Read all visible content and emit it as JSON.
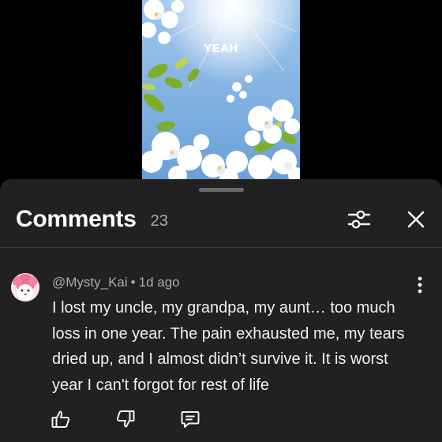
{
  "video": {
    "caption": "YEAH"
  },
  "comments_panel": {
    "title": "Comments",
    "count": "23",
    "filter_icon": "sliders-icon",
    "close_icon": "close-icon"
  },
  "comment": {
    "author": "@Mysty_Kai",
    "separator": "•",
    "time": "1d ago",
    "text": "I lost my uncle, my grandpa, my aunt… too much loss in one year. The pain exhausted me, my tears dried up, and I almost didn’t survive it. It is worst year I can't forgot for rest of life",
    "icons": [
      "avatar",
      "more-vert-icon",
      "thumbs-up-icon",
      "thumbs-down-icon",
      "reply-icon"
    ]
  },
  "colors": {
    "background": "#000000",
    "panel": "#212121",
    "text_primary": "#f1f1f1",
    "text_secondary": "#aaaaaa"
  }
}
